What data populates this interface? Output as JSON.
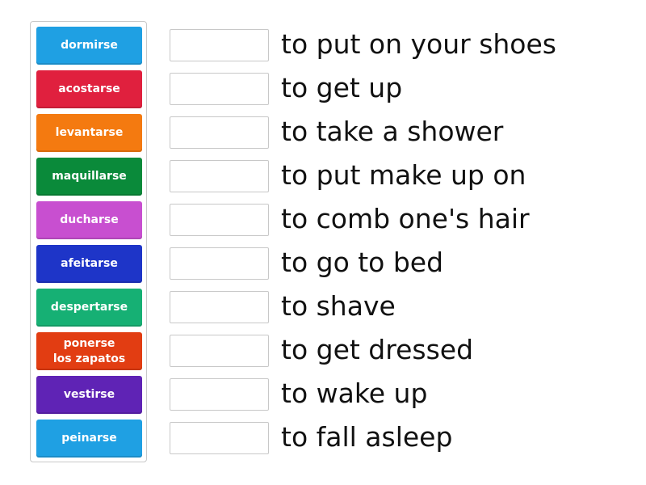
{
  "tiles": [
    {
      "label": "dormirse",
      "color": "#1fa0e3"
    },
    {
      "label": "acostarse",
      "color": "#e0203e"
    },
    {
      "label": "levantarse",
      "color": "#f47a10"
    },
    {
      "label": "maquillarse",
      "color": "#0a8a3a"
    },
    {
      "label": "ducharse",
      "color": "#c84fd0"
    },
    {
      "label": "afeitarse",
      "color": "#1e35c8"
    },
    {
      "label": "despertarse",
      "color": "#16b074"
    },
    {
      "label": "ponerse los zapatos",
      "color": "#e23d12"
    },
    {
      "label": "vestirse",
      "color": "#5f23b5"
    },
    {
      "label": "peinarse",
      "color": "#1fa0e3"
    }
  ],
  "definitions": [
    "to put on your shoes",
    "to get up",
    "to take a shower",
    "to put make up on",
    "to comb one's hair",
    "to go to bed",
    "to shave",
    "to get dressed",
    "to wake up",
    "to fall asleep"
  ]
}
